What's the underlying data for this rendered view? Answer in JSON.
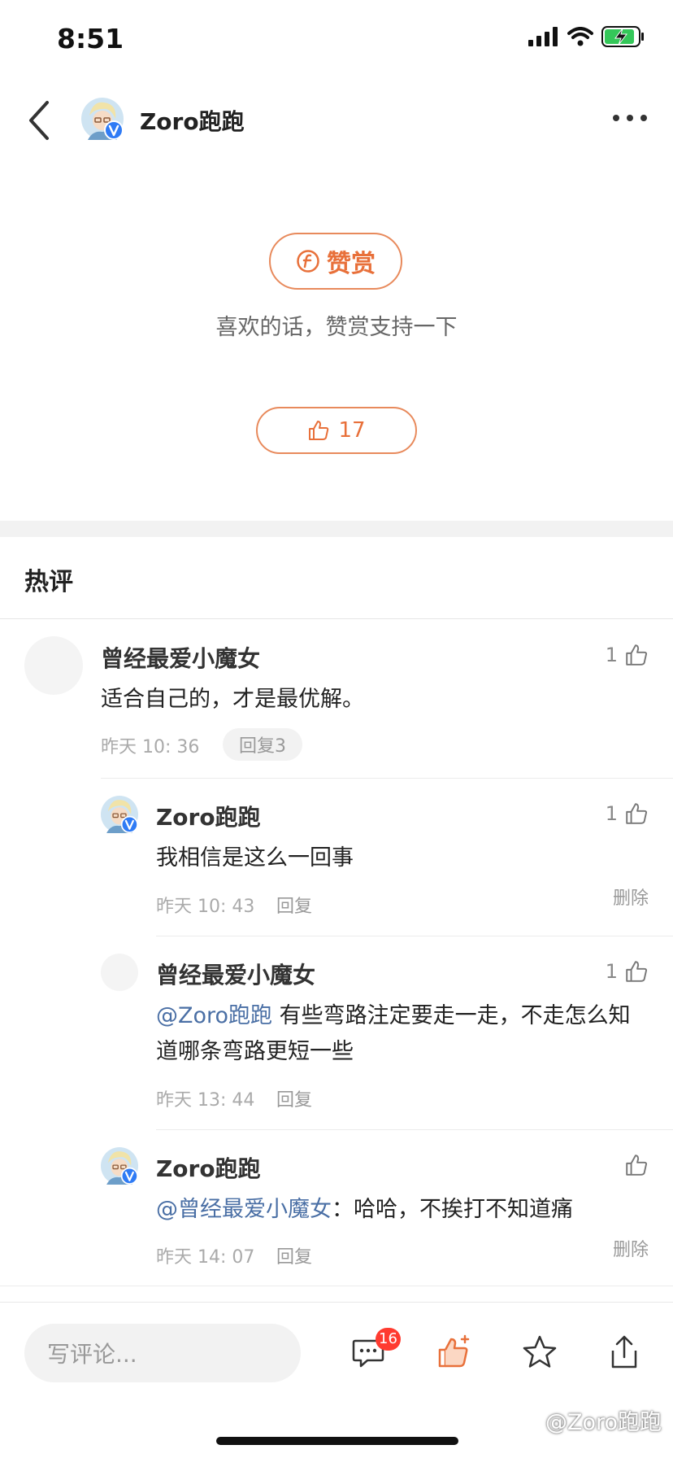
{
  "status_bar": {
    "time": "8:51"
  },
  "header": {
    "author_name": "Zoro跑跑"
  },
  "reward": {
    "button_label": "赞赏",
    "tip": "喜欢的话，赞赏支持一下",
    "like_count": "17"
  },
  "hot_comments": {
    "title": "热评",
    "main": {
      "name": "曾经最爱小魔女",
      "text": "适合自己的，才是最优解。",
      "time": "昨天 10: 36",
      "reply_label": "回复3",
      "likes": "1"
    },
    "replies": [
      {
        "name": "Zoro跑跑",
        "text": "我相信是这么一回事",
        "time": "昨天 10: 43",
        "reply_label": "回复",
        "likes": "1",
        "delete_label": "删除"
      },
      {
        "name": "曾经最爱小魔女",
        "mention": "@Zoro跑跑",
        "text": " 有些弯路注定要走一走，不走怎么知道哪条弯路更短一些",
        "time": "昨天 13: 44",
        "reply_label": "回复",
        "likes": "1"
      },
      {
        "name": "Zoro跑跑",
        "mention": "@曾经最爱小魔女",
        "text": "：哈哈，不挨打不知道痛",
        "time": "昨天 14: 07",
        "reply_label": "回复",
        "delete_label": "删除"
      }
    ]
  },
  "bottom_bar": {
    "input_placeholder": "写评论...",
    "comment_badge": "16"
  },
  "watermark": "@Zoro跑跑",
  "colors": {
    "accent": "#e8703a",
    "mention": "#4a6fa5",
    "verified": "#2f7bf5"
  }
}
